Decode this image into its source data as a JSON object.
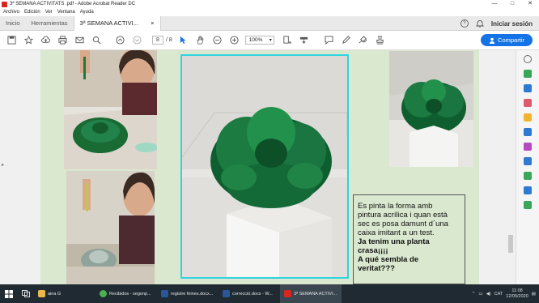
{
  "window": {
    "title": "3ª SEMANA ACTIVITATS .pdf - Adobe Acrobat Reader DC",
    "controls": [
      "—",
      "□",
      "✕"
    ]
  },
  "menu": [
    "Archivo",
    "Edición",
    "Ver",
    "Ventana",
    "Ayuda"
  ],
  "tabs": {
    "home": "Inicio",
    "tools": "Herramientas",
    "document": "3ª SEMANA ACTIVI...",
    "close": "×",
    "help": "?",
    "signin": "Iniciar sesión"
  },
  "toolbar": {
    "page_current": "8",
    "page_total": "/ 8",
    "zoom": "100%",
    "share_label": "Compartir"
  },
  "document": {
    "text_lines": [
      "Es pinta la forma amb",
      "pintura acrílica i quan està",
      "sec es posa damunt d´una",
      "caixa imitant a un test."
    ],
    "bold_lines": [
      "Ja tenim una planta",
      "crasa¡¡¡¡",
      "A qué sembla de",
      "veritat???"
    ]
  },
  "taskbar": {
    "items": [
      {
        "label": "aina G",
        "color": "#e8b84a"
      },
      {
        "label": "Recibidos - segonp...",
        "color": "#4caf50"
      },
      {
        "label": "registre feines.docx...",
        "color": "#2b5797"
      },
      {
        "label": "correcció.docx - W...",
        "color": "#2b5797"
      },
      {
        "label": "3ª SEMANA ACTIVI...",
        "color": "#d9261c"
      }
    ],
    "lang": "CAT",
    "time": "11:08",
    "date": "12/05/2020"
  },
  "colors": {
    "page_bg": "#d9e8cf",
    "accent": "#1473e6",
    "photo_frame": "#2fd3e0"
  }
}
